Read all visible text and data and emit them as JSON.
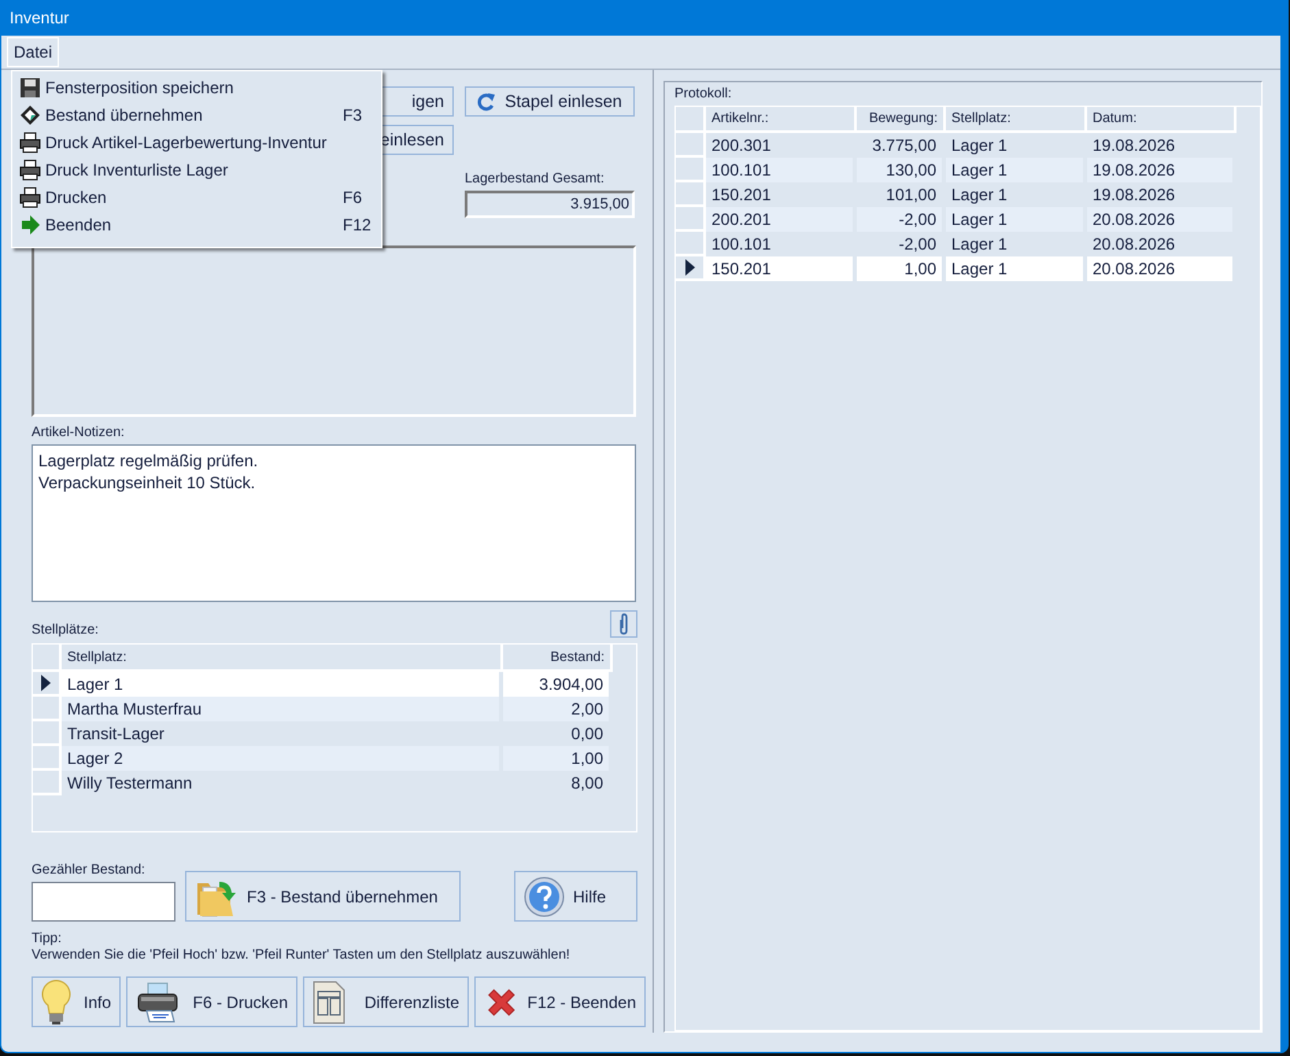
{
  "window": {
    "title": "Inventur"
  },
  "menubar": [
    {
      "label": "Datei",
      "selected": true
    }
  ],
  "menu": {
    "items": [
      {
        "kind": "floppy",
        "label": "Fensterposition speichern"
      },
      {
        "kind": "diamond",
        "label": "Bestand übernehmen",
        "shortcut": "F3"
      },
      {
        "kind": "printer",
        "label": "Druck Artikel-Lagerbewertung-Inventur"
      },
      {
        "kind": "printer",
        "label": "Druck Inventurliste Lager"
      },
      {
        "kind": "printer",
        "label": "Drucken",
        "shortcut": "F6"
      },
      {
        "kind": "arrow",
        "label": "Beenden",
        "shortcut": "F12"
      }
    ]
  },
  "top_buttons": [
    {
      "kind": "plain",
      "label": "igen"
    },
    {
      "kind": "refresh",
      "label": "Stapel einlesen"
    },
    {
      "kind": "plain",
      "label": "einlesen"
    }
  ],
  "stock_total": {
    "label": "Lagerbestand Gesamt:",
    "value": "3.915,00"
  },
  "notes": {
    "label": "Artikel-Notizen:",
    "lines": [
      "Lagerplatz regelmäßig prüfen.",
      "Verpackungseinheit 10 Stück."
    ]
  },
  "locations": {
    "label": "Stellplätze:",
    "columns": [
      "Stellplatz:",
      "Bestand:"
    ],
    "rows": [
      {
        "cells": [
          "Lager 1",
          "3.904,00"
        ],
        "selected": true
      },
      {
        "cells": [
          "Martha Musterfrau",
          "2,00"
        ],
        "selected": false
      },
      {
        "cells": [
          "Transit-Lager",
          "0,00"
        ],
        "selected": false
      },
      {
        "cells": [
          "Lager 2",
          "1,00"
        ],
        "selected": false
      },
      {
        "cells": [
          "Willy Testermann",
          "8,00"
        ],
        "selected": false
      }
    ]
  },
  "counted": {
    "label": "Gezähler Bestand:"
  },
  "actions": [
    {
      "kind": "folder",
      "label": "F3 - Bestand übernehmen"
    },
    {
      "kind": "help",
      "label": "Hilfe"
    }
  ],
  "tip": {
    "title": "Tipp:",
    "text": "Verwenden Sie die 'Pfeil Hoch' bzw. 'Pfeil Runter' Tasten um den Stellplatz auszuwählen!"
  },
  "bottom_buttons": [
    {
      "kind": "bulb",
      "label": "Info"
    },
    {
      "kind": "printer",
      "label": "F6 - Drucken"
    },
    {
      "kind": "document",
      "label": "Differenzliste"
    },
    {
      "kind": "cross",
      "label": "F12 - Beenden"
    }
  ],
  "protocol": {
    "label": "Protokoll:",
    "columns": [
      "Artikelnr.:",
      "Bewegung:",
      "Stellplatz:",
      "Datum:"
    ],
    "rows": [
      {
        "cells": [
          "200.301",
          "3.775,00",
          "Lager 1",
          "19.08.2026"
        ],
        "selected": false
      },
      {
        "cells": [
          "100.101",
          "130,00",
          "Lager 1",
          "19.08.2026"
        ],
        "selected": false
      },
      {
        "cells": [
          "150.201",
          "101,00",
          "Lager 1",
          "19.08.2026"
        ],
        "selected": false
      },
      {
        "cells": [
          "200.201",
          "-2,00",
          "Lager 1",
          "20.08.2026"
        ],
        "selected": false
      },
      {
        "cells": [
          "100.101",
          "-2,00",
          "Lager 1",
          "20.08.2026"
        ],
        "selected": false
      },
      {
        "cells": [
          "150.201",
          "1,00",
          "Lager 1",
          "20.08.2026"
        ],
        "selected": true
      }
    ]
  }
}
